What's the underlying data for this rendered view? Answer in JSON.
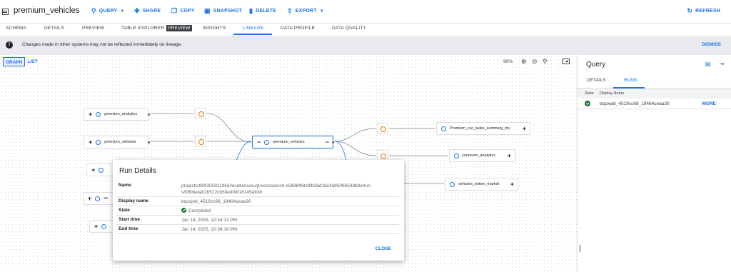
{
  "header": {
    "title": "premium_vehicles",
    "actions": [
      {
        "label": "QUERY",
        "icon": "search-icon",
        "caret": true
      },
      {
        "label": "SHARE",
        "icon": "share-icon"
      },
      {
        "label": "COPY",
        "icon": "copy-icon"
      },
      {
        "label": "SNAPSHOT",
        "icon": "snapshot-icon"
      },
      {
        "label": "DELETE",
        "icon": "delete-icon"
      },
      {
        "label": "EXPORT",
        "icon": "export-icon",
        "caret": true
      }
    ],
    "refresh_label": "REFRESH"
  },
  "tabs": [
    "SCHEMA",
    "DETAILS",
    "PREVIEW",
    "TABLE EXPLORER",
    "INSIGHTS",
    "LINEAGE",
    "DATA PROFILE",
    "DATA QUALITY"
  ],
  "tab_badge": "PREVIEW",
  "active_tab": "LINEAGE",
  "banner": {
    "message": "Changes made in other systems may not be reflected immediately on lineage.",
    "dismiss_label": "DISMISS"
  },
  "graph": {
    "view_graph": "GRAPH",
    "view_list": "LIST",
    "zoom": "90%",
    "nodes": {
      "left_1": "premium_analytics",
      "left_2": "premium_vehicles",
      "center": "premium_vehicles",
      "right_1": "Premium_car_sales_summary_mv",
      "right_2": "premium_analytics",
      "right_3": "vehicles_below_market",
      "left_4_partial": "ve"
    }
  },
  "side_panel": {
    "title": "Query",
    "tabs": [
      "DETAILS",
      "RUNS"
    ],
    "active_tab": "RUNS",
    "columns": [
      "State",
      "Display Name"
    ],
    "rows": [
      {
        "display_name": "bquxjob_4519cc68_19464ceaa30",
        "action": "MORE"
      }
    ]
  },
  "modal": {
    "title": "Run Details",
    "fields": [
      {
        "key": "Name",
        "value": "projects/999305911963/locations/eu/processes/sh-e5b96fb8cf8b26d1bc4a9509653db9e/runs/0ff0befab2b512cb58ed0df18145a938"
      },
      {
        "key": "Display name",
        "value": "bquxjob_4519cc68_19464ceaa30"
      },
      {
        "key": "State",
        "value": "Completed"
      },
      {
        "key": "Start time",
        "value": "Jan 14, 2025, 12:34:13 PM"
      },
      {
        "key": "End time",
        "value": "Jan 14, 2025, 12:34:16 PM"
      }
    ],
    "close_label": "CLOSE"
  },
  "colors": {
    "accent": "#1a73e8",
    "success": "#137333",
    "process": "#e37400"
  }
}
